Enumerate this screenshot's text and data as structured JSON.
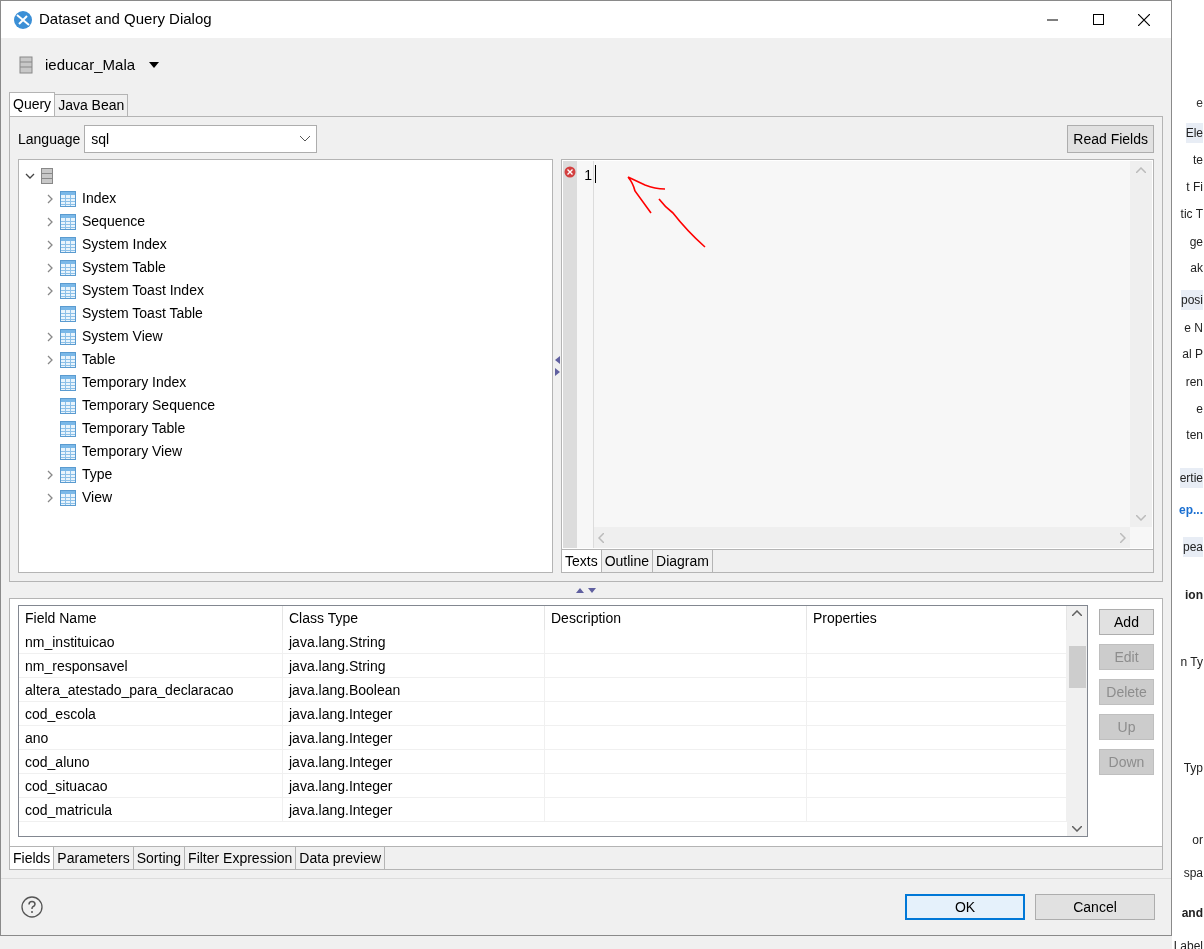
{
  "window": {
    "title": "Dataset and Query Dialog"
  },
  "data_source": {
    "name": "ieducar_Mala"
  },
  "query_tabs": [
    {
      "label": "Query",
      "selected": true
    },
    {
      "label": "Java Bean",
      "selected": false
    }
  ],
  "language": {
    "label": "Language",
    "value": "sql"
  },
  "read_fields_button": "Read Fields",
  "tree": {
    "expanded": true,
    "children": [
      {
        "label": "Index",
        "expandable": true
      },
      {
        "label": "Sequence",
        "expandable": true
      },
      {
        "label": "System Index",
        "expandable": true
      },
      {
        "label": "System Table",
        "expandable": true
      },
      {
        "label": "System Toast Index",
        "expandable": true
      },
      {
        "label": "System Toast Table",
        "expandable": false
      },
      {
        "label": "System View",
        "expandable": true
      },
      {
        "label": "Table",
        "expandable": true
      },
      {
        "label": "Temporary Index",
        "expandable": false
      },
      {
        "label": "Temporary Sequence",
        "expandable": false
      },
      {
        "label": "Temporary Table",
        "expandable": false
      },
      {
        "label": "Temporary View",
        "expandable": false
      },
      {
        "label": "Type",
        "expandable": true
      },
      {
        "label": "View",
        "expandable": true
      }
    ]
  },
  "editor": {
    "lines": [
      {
        "number": "1",
        "error": true
      }
    ]
  },
  "editor_tabs": [
    {
      "label": "Texts",
      "selected": true
    },
    {
      "label": "Outline",
      "selected": false
    },
    {
      "label": "Diagram",
      "selected": false
    }
  ],
  "table": {
    "columns": [
      "Field Name",
      "Class Type",
      "Description",
      "Properties"
    ],
    "rows": [
      [
        "nm_instituicao",
        "java.lang.String",
        "",
        ""
      ],
      [
        "nm_responsavel",
        "java.lang.String",
        "",
        ""
      ],
      [
        "altera_atestado_para_declaracao",
        "java.lang.Boolean",
        "",
        ""
      ],
      [
        "cod_escola",
        "java.lang.Integer",
        "",
        ""
      ],
      [
        "ano",
        "java.lang.Integer",
        "",
        ""
      ],
      [
        "cod_aluno",
        "java.lang.Integer",
        "",
        ""
      ],
      [
        "cod_situacao",
        "java.lang.Integer",
        "",
        ""
      ],
      [
        "cod_matricula",
        "java.lang.Integer",
        "",
        ""
      ]
    ]
  },
  "side_buttons": [
    {
      "label": "Add",
      "disabled": false
    },
    {
      "label": "Edit",
      "disabled": true
    },
    {
      "label": "Delete",
      "disabled": true
    },
    {
      "label": "Up",
      "disabled": true
    },
    {
      "label": "Down",
      "disabled": true
    }
  ],
  "bottom_tabs": [
    {
      "label": "Fields",
      "selected": true
    },
    {
      "label": "Parameters",
      "selected": false
    },
    {
      "label": "Sorting",
      "selected": false
    },
    {
      "label": "Filter Expression",
      "selected": false
    },
    {
      "label": "Data preview",
      "selected": false
    }
  ],
  "footer_buttons": [
    {
      "label": "OK",
      "default": true
    },
    {
      "label": "Cancel",
      "default": false
    }
  ],
  "background_window": {
    "fragments": [
      {
        "text": "e",
        "kind": "tab"
      },
      {
        "text": "Ele",
        "kind": "header"
      },
      {
        "text": "te",
        "kind": "item"
      },
      {
        "text": "t Fi",
        "kind": "item"
      },
      {
        "text": "tic T",
        "kind": "item"
      },
      {
        "text": "ge",
        "kind": "item"
      },
      {
        "text": "ak",
        "kind": "item"
      },
      {
        "text": "posi",
        "kind": "header"
      },
      {
        "text": "e N",
        "kind": "item"
      },
      {
        "text": "al P",
        "kind": "item"
      },
      {
        "text": "ren",
        "kind": "item"
      },
      {
        "text": "e",
        "kind": "item"
      },
      {
        "text": "ten",
        "kind": "item"
      },
      {
        "text": "ertie",
        "kind": "header"
      },
      {
        "text": "ep...",
        "kind": "link"
      },
      {
        "text": "pea",
        "kind": "header"
      },
      {
        "text": "ion",
        "kind": "bold"
      },
      {
        "text": "n Ty",
        "kind": "item"
      },
      {
        "text": "Typ",
        "kind": "item"
      },
      {
        "text": "or",
        "kind": "item"
      },
      {
        "text": "spa",
        "kind": "item"
      },
      {
        "text": "and",
        "kind": "bold"
      },
      {
        "text": "Label",
        "kind": "item"
      }
    ]
  }
}
